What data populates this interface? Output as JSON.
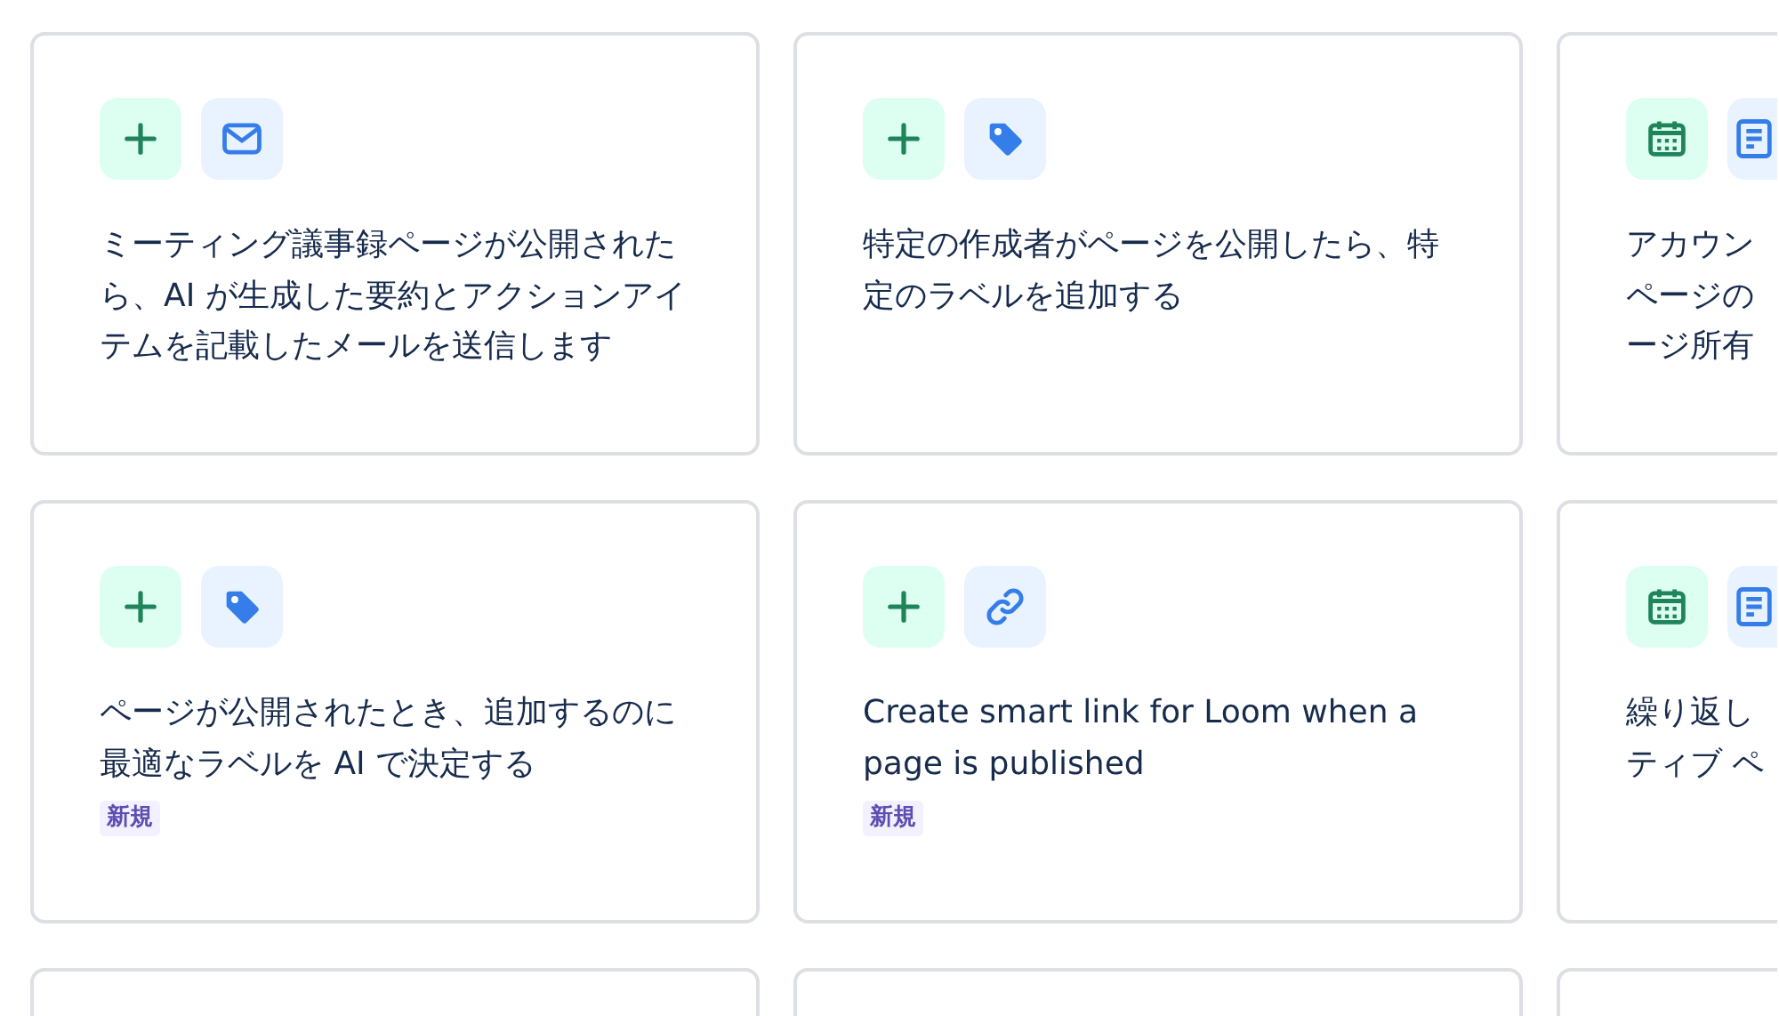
{
  "cards": [
    {
      "kind": "template",
      "icons": [
        {
          "kind": "plus"
        },
        {
          "kind": "mail"
        }
      ],
      "description": "ミーティング議事録ページが公開されたら、AI が生成した要約とアクションアイテムを記載したメールを送信します"
    },
    {
      "kind": "template",
      "icons": [
        {
          "kind": "plus"
        },
        {
          "kind": "tag"
        }
      ],
      "description": "特定の作成者がページを公開したら、特定のラベルを追加する"
    },
    {
      "kind": "template",
      "icons": [
        {
          "kind": "calendar"
        },
        {
          "kind": "document"
        }
      ],
      "description_lines": [
        "アカウン",
        "ページの",
        "ージ所有"
      ]
    },
    {
      "kind": "template",
      "icons": [
        {
          "kind": "plus"
        },
        {
          "kind": "tag"
        }
      ],
      "description": "ページが公開されたとき、追加するのに最適なラベルを AI で決定する",
      "badge": "新規"
    },
    {
      "kind": "template",
      "icons": [
        {
          "kind": "plus"
        },
        {
          "kind": "link"
        }
      ],
      "description": "Create smart link for Loom when a page is published",
      "badge": "新規"
    },
    {
      "kind": "template",
      "icons": [
        {
          "kind": "calendar"
        },
        {
          "kind": "document"
        }
      ],
      "description_lines": [
        "繰り返し",
        "ティブ ペ"
      ]
    },
    {
      "kind": "blank"
    },
    {
      "kind": "blank"
    },
    {
      "kind": "blank"
    }
  ]
}
